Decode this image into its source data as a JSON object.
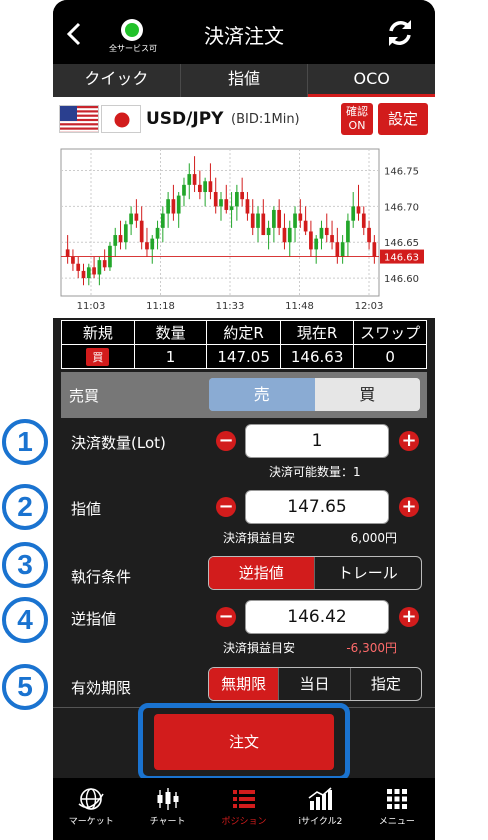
{
  "header": {
    "title": "決済注文",
    "status_label": "全サービス可"
  },
  "tabs": [
    {
      "label": "クイック"
    },
    {
      "label": "指値"
    },
    {
      "label": "OCO"
    }
  ],
  "pair": {
    "name": "USD/JPY",
    "sub": "(BID:1Min)",
    "confirm_label_1": "確認",
    "confirm_label_2": "ON",
    "settings_label": "設定"
  },
  "chart_data": {
    "type": "candlestick",
    "y_ticks": [
      "146.75",
      "146.70",
      "146.65",
      "146.60"
    ],
    "x_ticks": [
      "11:03",
      "11:18",
      "11:33",
      "11:48",
      "12:03"
    ],
    "current_price": "146.63",
    "ylim": [
      146.575,
      146.78
    ],
    "candles": [
      [
        146.64,
        146.66,
        146.62,
        146.63
      ],
      [
        146.63,
        146.64,
        146.61,
        146.62
      ],
      [
        146.62,
        146.63,
        146.6,
        146.61
      ],
      [
        146.61,
        146.62,
        146.59,
        146.6
      ],
      [
        146.6,
        146.62,
        146.59,
        146.615
      ],
      [
        146.615,
        146.63,
        146.6,
        146.605
      ],
      [
        146.605,
        146.63,
        146.59,
        146.625
      ],
      [
        146.625,
        146.64,
        146.61,
        146.615
      ],
      [
        146.615,
        146.65,
        146.61,
        146.645
      ],
      [
        146.645,
        146.67,
        146.63,
        146.66
      ],
      [
        146.66,
        146.68,
        146.64,
        146.65
      ],
      [
        146.65,
        146.68,
        146.64,
        146.675
      ],
      [
        146.675,
        146.7,
        146.66,
        146.69
      ],
      [
        146.69,
        146.71,
        146.67,
        146.68
      ],
      [
        146.68,
        146.7,
        146.64,
        146.65
      ],
      [
        146.65,
        146.67,
        146.63,
        146.64
      ],
      [
        146.64,
        146.66,
        146.62,
        146.655
      ],
      [
        146.655,
        146.68,
        146.64,
        146.67
      ],
      [
        146.67,
        146.7,
        146.65,
        146.69
      ],
      [
        146.69,
        146.72,
        146.67,
        146.71
      ],
      [
        146.71,
        146.73,
        146.68,
        146.69
      ],
      [
        146.69,
        146.72,
        146.67,
        146.715
      ],
      [
        146.715,
        146.74,
        146.7,
        146.73
      ],
      [
        146.73,
        146.76,
        146.71,
        146.745
      ],
      [
        146.745,
        146.77,
        146.72,
        146.73
      ],
      [
        146.73,
        146.75,
        146.71,
        146.72
      ],
      [
        146.72,
        146.74,
        146.7,
        146.735
      ],
      [
        146.735,
        146.76,
        146.71,
        146.72
      ],
      [
        146.72,
        146.74,
        146.69,
        146.7
      ],
      [
        146.7,
        146.72,
        146.68,
        146.71
      ],
      [
        146.71,
        146.73,
        146.69,
        146.695
      ],
      [
        146.695,
        146.72,
        146.67,
        146.7
      ],
      [
        146.7,
        146.73,
        146.68,
        146.72
      ],
      [
        146.72,
        146.74,
        146.7,
        146.71
      ],
      [
        146.71,
        146.72,
        146.68,
        146.69
      ],
      [
        146.69,
        146.71,
        146.66,
        146.67
      ],
      [
        146.67,
        146.7,
        146.65,
        146.69
      ],
      [
        146.69,
        146.71,
        146.66,
        146.66
      ],
      [
        146.66,
        146.68,
        146.64,
        146.67
      ],
      [
        146.67,
        146.7,
        146.65,
        146.695
      ],
      [
        146.695,
        146.71,
        146.66,
        146.67
      ],
      [
        146.67,
        146.69,
        146.64,
        146.65
      ],
      [
        146.65,
        146.68,
        146.63,
        146.67
      ],
      [
        146.67,
        146.7,
        146.65,
        146.69
      ],
      [
        146.69,
        146.71,
        146.67,
        146.68
      ],
      [
        146.68,
        146.7,
        146.66,
        146.665
      ],
      [
        146.665,
        146.68,
        146.63,
        146.64
      ],
      [
        146.64,
        146.66,
        146.62,
        146.655
      ],
      [
        146.655,
        146.68,
        146.64,
        146.67
      ],
      [
        146.67,
        146.69,
        146.65,
        146.66
      ],
      [
        146.66,
        146.68,
        146.64,
        146.65
      ],
      [
        146.65,
        146.67,
        146.62,
        146.63
      ],
      [
        146.63,
        146.66,
        146.62,
        146.65
      ],
      [
        146.65,
        146.69,
        146.63,
        146.68
      ],
      [
        146.68,
        146.72,
        146.67,
        146.7
      ],
      [
        146.7,
        146.73,
        146.68,
        146.69
      ],
      [
        146.69,
        146.7,
        146.66,
        146.67
      ],
      [
        146.67,
        146.68,
        146.64,
        146.65
      ],
      [
        146.65,
        146.66,
        146.62,
        146.63
      ]
    ]
  },
  "position_table": {
    "headers": [
      "新規",
      "数量",
      "約定R",
      "現在R",
      "スワップ"
    ],
    "row": {
      "side": "買",
      "qty": "1",
      "exec_rate": "147.05",
      "current_rate": "146.63",
      "swap": "0"
    }
  },
  "side": {
    "label": "売買",
    "options": [
      "売",
      "買"
    ],
    "selected": "売"
  },
  "quantity": {
    "label": "決済数量(Lot)",
    "value": "1",
    "sub": "決済可能数量：1"
  },
  "limit": {
    "label": "指値",
    "value": "147.65",
    "sub": "決済損益目安",
    "pl": "6,000円",
    "pl_color": "#ffffff"
  },
  "exec_cond": {
    "label": "執行条件",
    "options": [
      "逆指値",
      "トレール"
    ],
    "selected": "逆指値"
  },
  "stop": {
    "label": "逆指値",
    "value": "146.42",
    "sub": "決済損益目安",
    "pl": "-6,300円",
    "pl_color": "#ff6b6b"
  },
  "expiry": {
    "label": "有効期限",
    "options": [
      "無期限",
      "当日",
      "指定"
    ],
    "selected": "無期限"
  },
  "callouts": [
    "1",
    "2",
    "3",
    "4",
    "5"
  ],
  "order_button": "注文",
  "bottom_nav": [
    {
      "label": "マーケット",
      "icon": "globe-icon"
    },
    {
      "label": "チャート",
      "icon": "candlestick-icon"
    },
    {
      "label": "ポジション",
      "icon": "list-icon"
    },
    {
      "label": "iサイクル2",
      "icon": "bar-chart-icon"
    },
    {
      "label": "メニュー",
      "icon": "grid-icon"
    }
  ],
  "colors": {
    "accent": "#d21c1c",
    "highlight": "#1a73d0",
    "up": "#22a62a",
    "down": "#d21c1c"
  }
}
